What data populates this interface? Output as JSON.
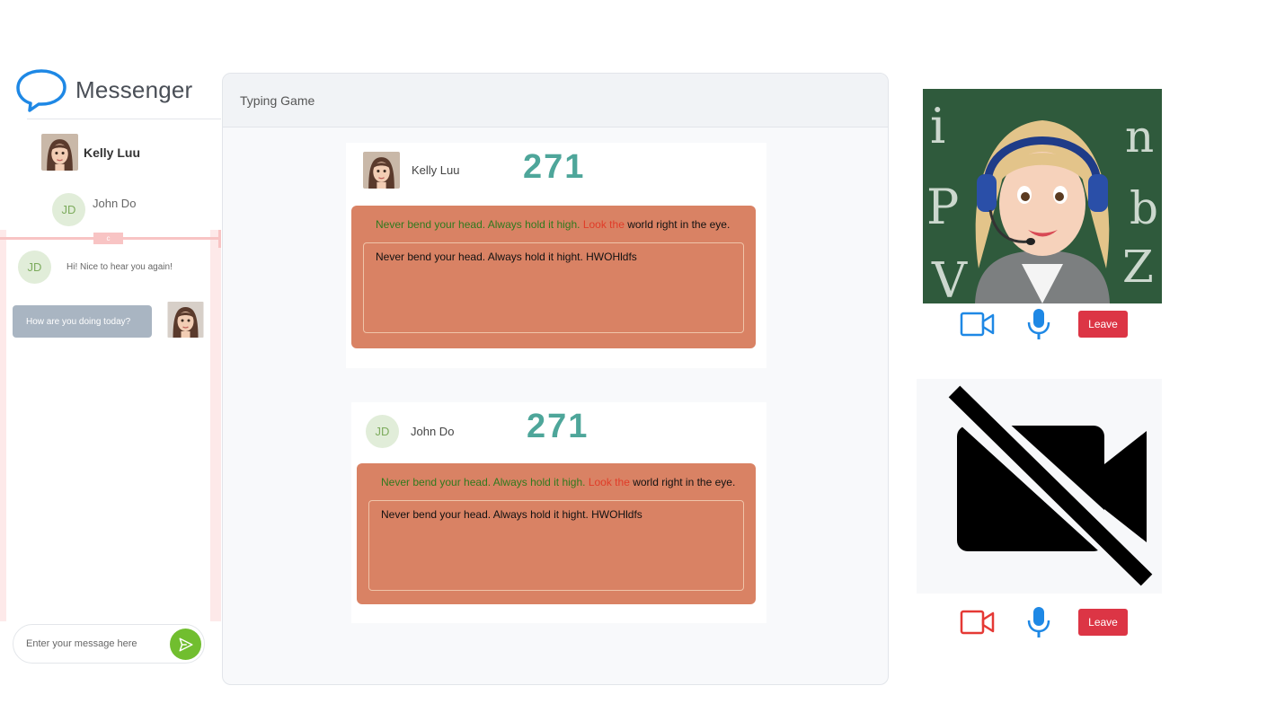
{
  "app": {
    "name": "Messenger"
  },
  "sidebar": {
    "contacts": [
      {
        "name": "Kelly Luu",
        "avatar": "photo"
      },
      {
        "name": "John Do",
        "initials": "JD"
      }
    ],
    "handle_label": "c"
  },
  "chat": {
    "messages": [
      {
        "from": "John Do",
        "initials": "JD",
        "text": "Hi! Nice to hear you again!",
        "direction": "incoming"
      },
      {
        "from": "Kelly Luu",
        "text": "How are you doing today?",
        "direction": "outgoing"
      }
    ],
    "composer": {
      "placeholder": "Enter your message here",
      "value": ""
    }
  },
  "game": {
    "title": "Typing Game",
    "players": [
      {
        "name": "Kelly Luu",
        "avatar": "photo",
        "score": "271",
        "target_done": "Never bend your head. Always hold it high.",
        "target_error": "Look the",
        "target_rest": "world right in the eye.",
        "typed": "Never bend your head. Always hold it hight. HWOHldfs"
      },
      {
        "name": "John Do",
        "initials": "JD",
        "score": "271",
        "target_done": "Never bend your head. Always hold it high.",
        "target_error": "Look the",
        "target_rest": "world right in the eye.",
        "typed": "Never bend your head. Always hold it hight. HWOHldfs"
      }
    ]
  },
  "video": {
    "tiles": [
      {
        "state": "camera-on",
        "camera_icon_color": "#1e88e5",
        "mic_icon_color": "#1e88e5",
        "leave_label": "Leave"
      },
      {
        "state": "camera-off",
        "camera_icon_color": "#e53935",
        "mic_icon_color": "#1e88e5",
        "leave_label": "Leave"
      }
    ]
  },
  "colors": {
    "accent_green": "#71be2f",
    "score_teal": "#4ea69a",
    "typing_box": "#d98264",
    "correct_text": "#2f7a1e",
    "error_text": "#e03c28",
    "leave_red": "#dc3545",
    "messenger_blue": "#1e88e5"
  }
}
